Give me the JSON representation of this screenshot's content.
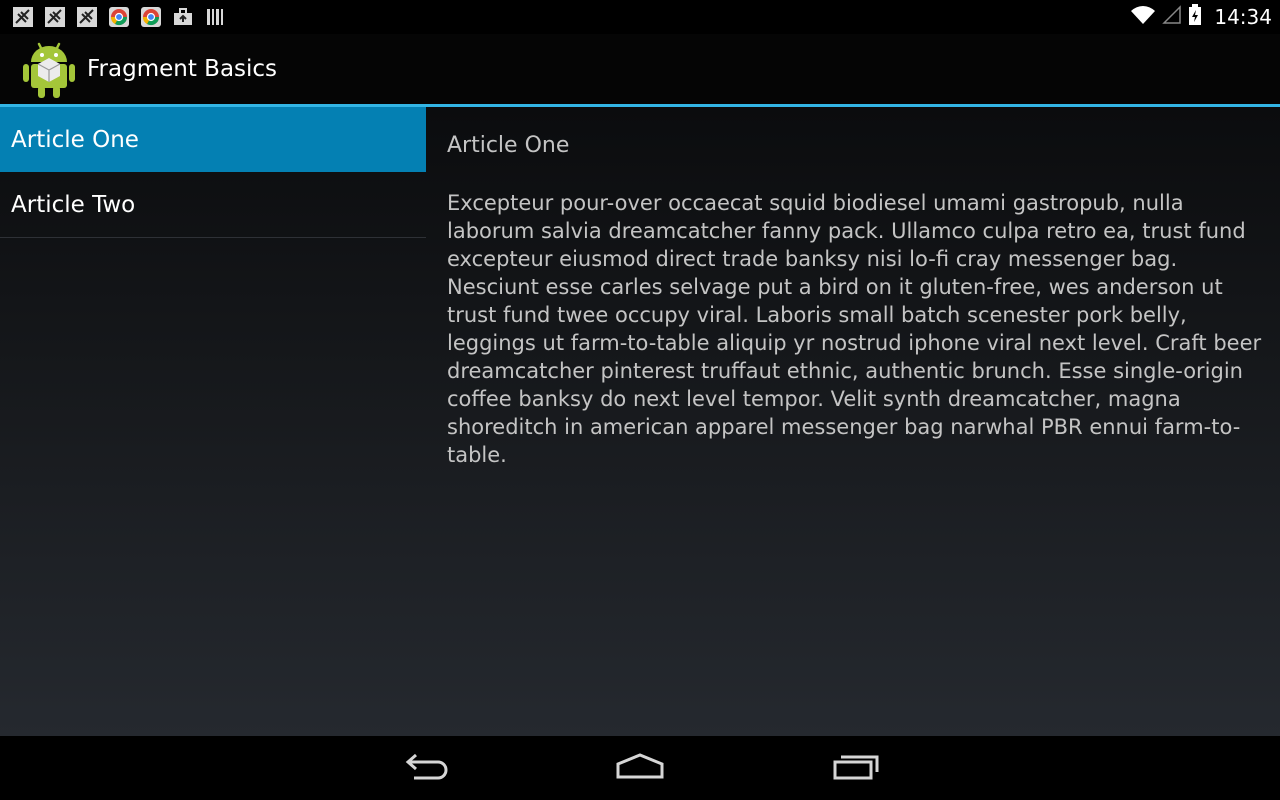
{
  "status_bar": {
    "time": "14:34",
    "notification_icons": [
      "signal-strike-icon",
      "signal-strike-icon",
      "signal-strike-icon",
      "chrome-icon",
      "chrome-icon",
      "briefcase-icon",
      "barcode-icon"
    ]
  },
  "action_bar": {
    "title": "Fragment Basics"
  },
  "headlines": {
    "items": [
      {
        "label": "Article One",
        "selected": true
      },
      {
        "label": "Article Two",
        "selected": false
      }
    ]
  },
  "article": {
    "title": "Article One",
    "body": "Excepteur pour-over occaecat squid biodiesel umami gastropub, nulla laborum salvia dreamcatcher fanny pack. Ullamco culpa retro ea, trust fund excepteur eiusmod direct trade banksy nisi lo-fi cray messenger bag. Nesciunt esse carles selvage put a bird on it gluten-free, wes anderson ut trust fund twee occupy viral. Laboris small batch scenester pork belly, leggings ut farm-to-table aliquip yr nostrud iphone viral next level. Craft beer dreamcatcher pinterest truffaut ethnic, authentic brunch. Esse single-origin coffee banksy do next level tempor. Velit synth dreamcatcher, magna shoreditch in american apparel messenger bag narwhal PBR ennui farm-to-table."
  },
  "colors": {
    "accent": "#33b5e5",
    "selected_item": "#0480b3",
    "text_secondary": "#c4c4c4"
  },
  "nav_bar": {
    "buttons": [
      "back-icon",
      "home-icon",
      "recents-icon"
    ]
  }
}
